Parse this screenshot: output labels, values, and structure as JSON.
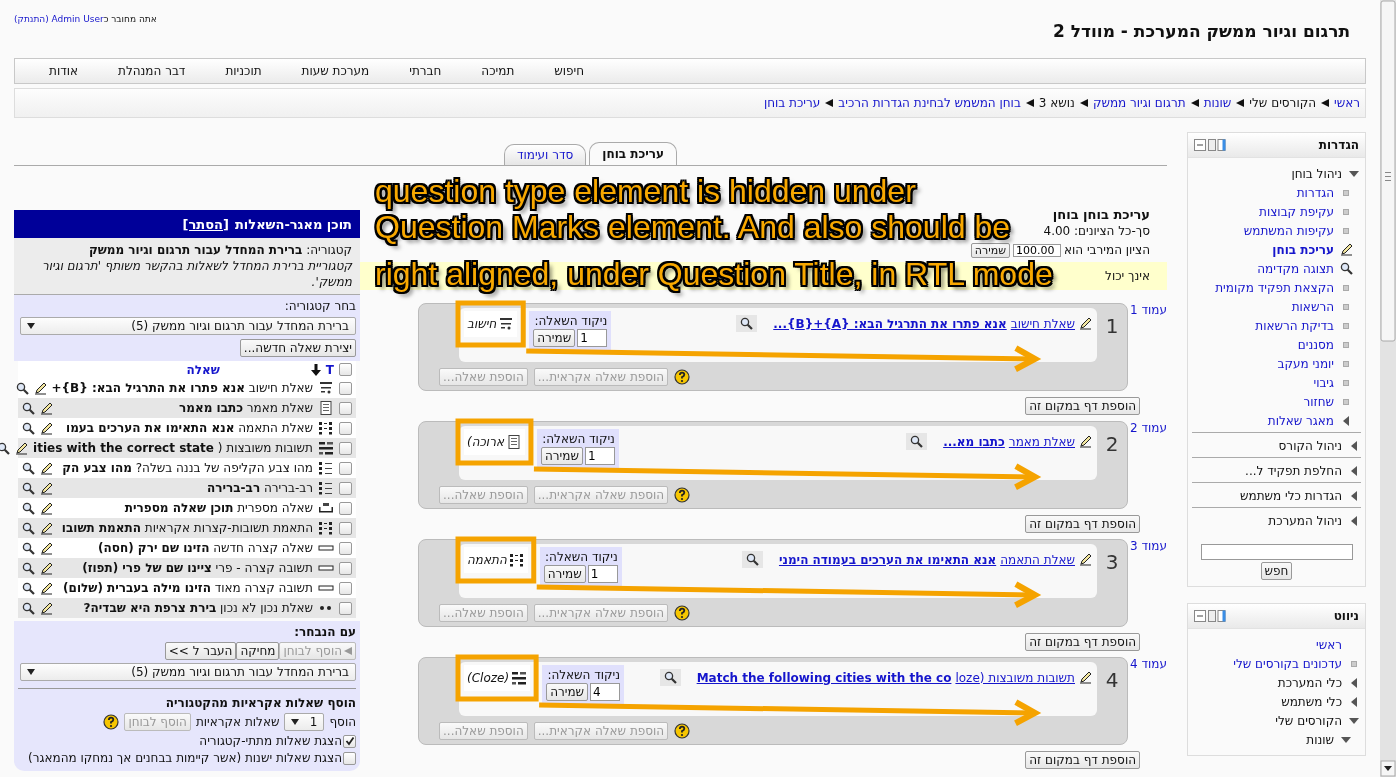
{
  "header": {
    "login_prefix": "אתה מחובר כ",
    "user": "Admin User",
    "logout": "(התנתק)",
    "site_title": "תרגום וגיור ממשק המערכת - מוודל 2"
  },
  "menu": [
    "חיפוש",
    "תמיכה",
    "חברתי",
    "מערכת שעות",
    "תוכניות",
    "דבר המנהלת",
    "אודות"
  ],
  "breadcrumb": [
    {
      "label": "ראשי",
      "link": true
    },
    {
      "label": "הקורסים שלי",
      "link": false
    },
    {
      "label": "שונות",
      "link": true
    },
    {
      "label": "תרגום וגיור ממשק",
      "link": true
    },
    {
      "label": "נושא 3",
      "link": false
    },
    {
      "label": "בוחן המשמש לבחינת הגדרות הרכיב",
      "link": true
    },
    {
      "label": "עריכת בוחן",
      "link": true
    }
  ],
  "tabs": [
    {
      "label": "עריכת בוחן",
      "selected": true
    },
    {
      "label": "סדר ועימוד",
      "selected": false
    }
  ],
  "bank": {
    "title": "תוכן מאגר-השאלות",
    "hide_link": "[הסתר]",
    "category_label": "קטגוריה:",
    "category_name": "ברירת המחדל עבור תרגום וגיור ממשק",
    "category_info": "קטגוריית ברירת המחדל לשאלות בהקשר משותף 'תרגום וגיור ממשק'.",
    "choose_label": "בחר קטגוריה:",
    "category_select": "ברירת המחדל עבור תרגום וגיור ממשק (5)",
    "new_button": "יצירת שאלה חדשה...",
    "select_all_checked": false,
    "type_column": "T",
    "question_column": "שאלה",
    "rows": [
      {
        "kind": "calculated",
        "type": "שאלת חישוב",
        "title": "אנא פתרו את התרגיל הבא: {B}+",
        "checked": false
      },
      {
        "kind": "essay",
        "type": "שאלת מאמר",
        "title": "כתבו מאמר",
        "checked": false
      },
      {
        "kind": "matching",
        "type": "שאלת התאמה",
        "title": "אנא התאימו את הערכים בעמו",
        "checked": false
      },
      {
        "kind": "multianswer",
        "type": "תשובות משובצות (",
        "title": "ities with the correct state",
        "checked": false
      },
      {
        "kind": "multichoice",
        "type": "מהו צבע הקליפה של בננה בשלה?",
        "title": "מהו צבע הק",
        "checked": false
      },
      {
        "kind": "multichoice",
        "type": "רב-ברירה",
        "title": "רב-ברירה",
        "checked": false
      },
      {
        "kind": "numerical",
        "type": "שאלה מספרית",
        "title": "תוכן שאלה מספרית",
        "checked": false
      },
      {
        "kind": "randomsamatch",
        "type": "התאמת תשובות-קצרות אקראיות",
        "title": "התאמת תשובו",
        "checked": false
      },
      {
        "kind": "shortanswer",
        "type": "שאלה קצרה חדשה",
        "title": "הזינו שם ירק (חסה)",
        "checked": false
      },
      {
        "kind": "shortanswer",
        "type": "תשובה קצרה - פרי",
        "title": "ציינו שם של פרי (תפוז)",
        "checked": false
      },
      {
        "kind": "shortanswer",
        "type": "תשובה קצרה מאוד",
        "title": "הזינו מילה בעברית (שלום)",
        "checked": false
      },
      {
        "kind": "truefalse",
        "type": "שאלת נכון לא נכון",
        "title": "בירת צרפת היא שבדיה?",
        "checked": false
      }
    ],
    "with_selected": "עם הנבחר:",
    "actions": [
      {
        "label": "הוסף לבוחן",
        "disabled": true
      },
      {
        "label": "מחיקה",
        "disabled": false
      },
      {
        "label": "העבר ל >>",
        "disabled": false
      }
    ],
    "move_select": "ברירת המחדל עבור תרגום וגיור ממשק (5)",
    "random_title": "הוסף שאלות אקראיות מהקטגוריה",
    "random_add": "הוסף",
    "random_count": "1",
    "random_label": "שאלות אקראיות",
    "random_button": {
      "label": "הוסף לבוחן",
      "disabled": true
    },
    "options": [
      {
        "label": "הצגת שאלות מתתי-קטגוריה",
        "checked": true
      },
      {
        "label": "הצגת שאלות ישנות (אשר קיימות בבחנים אך נמחקו מהמאגר)",
        "checked": false
      }
    ]
  },
  "quiz": {
    "heading": "עריכת בוחן בוחן",
    "total": "סך-כל הציונים: 4.00",
    "max_label": "הציון המירבי הוא",
    "max_value": "100.00",
    "save": "שמירה",
    "notice": "אינך יכול"
  },
  "pages": [
    {
      "page_label": "עמוד 1",
      "number": "1",
      "type_link": "שאלת חישוב",
      "title": "אנא פתרו את התרגיל הבא: {A}+{B}...",
      "grade_label": "ניקוד השאלה:",
      "grade": "1",
      "save": "שמירה",
      "qtype": {
        "kind": "calculated",
        "label": "חישוב"
      },
      "add_random": "הוספת שאלה אקראית...",
      "add_question": "הוספת שאלה...",
      "add_disabled": true,
      "add_page": "הוספת דף במקום זה",
      "annotated": true
    },
    {
      "page_label": "עמוד 2",
      "number": "2",
      "type_link": "שאלת מאמר",
      "title": "כתבו מא...",
      "grade_label": "ניקוד השאלה:",
      "grade": "1",
      "save": "שמירה",
      "qtype": {
        "kind": "essay",
        "label": "ארוכה)"
      },
      "add_random": "הוספת שאלה אקראית...",
      "add_question": "הוספת שאלה...",
      "add_disabled": true,
      "add_page": "הוספת דף במקום זה",
      "annotated": true
    },
    {
      "page_label": "עמוד 3",
      "number": "3",
      "type_link": "שאלת התאמה",
      "title": "אנא התאימו את הערכים בעמודה הימני",
      "grade_label": "ניקוד השאלה:",
      "grade": "1",
      "save": "שמירה",
      "qtype": {
        "kind": "matching",
        "label": "התאמה"
      },
      "add_random": "הוספת שאלה אקראית...",
      "add_question": "הוספת שאלה...",
      "add_disabled": true,
      "add_page": "הוספת דף במקום זה",
      "annotated": true
    },
    {
      "page_label": "עמוד 4",
      "number": "4",
      "type_link": "תשובות משובצות (loze",
      "title": "Match the following cities with the co",
      "grade_label": "ניקוד השאלה:",
      "grade": "4",
      "save": "שמירה",
      "qtype": {
        "kind": "multianswer",
        "label": "(Cloze)"
      },
      "add_random": "הוספת שאלה אקראית...",
      "add_question": "הוספת שאלה...",
      "add_disabled": true,
      "add_page": "הוספת דף במקום זה",
      "annotated": true
    }
  ],
  "annotation": {
    "lines": [
      "question type element is hidden under",
      "Question Marks element. And also should be",
      "right aligned, under Question Title, in RTL mode"
    ]
  },
  "settings": {
    "title": "הגדרות",
    "search_button": "חפש",
    "tree": [
      {
        "label": "ניהול בוחן",
        "kind": "branch",
        "expanded": true,
        "link": false,
        "children": [
          {
            "label": "הגדרות",
            "kind": "bullet",
            "selected": false
          },
          {
            "label": "עקיפת קבוצות",
            "kind": "bullet",
            "selected": false
          },
          {
            "label": "עקיפות המשתמש",
            "kind": "bullet",
            "selected": false
          },
          {
            "label": "עריכת בוחן",
            "kind": "edit",
            "selected": true
          },
          {
            "label": "תצוגה מקדימה",
            "kind": "preview",
            "selected": false
          },
          {
            "label": "הקצאת תפקיד מקומית",
            "kind": "bullet",
            "selected": false
          },
          {
            "label": "הרשאות",
            "kind": "bullet",
            "selected": false
          },
          {
            "label": "בדיקת הרשאות",
            "kind": "bullet",
            "selected": false
          },
          {
            "label": "מסננים",
            "kind": "bullet",
            "selected": false
          },
          {
            "label": "יומני מעקב",
            "kind": "bullet",
            "selected": false
          },
          {
            "label": "גיבוי",
            "kind": "bullet",
            "selected": false
          },
          {
            "label": "שחזור",
            "kind": "bullet",
            "selected": false
          },
          {
            "label": "מאגר שאלות",
            "kind": "branch",
            "expanded": false,
            "link": true
          }
        ]
      },
      {
        "label": "ניהול הקורס",
        "kind": "branch",
        "expanded": false,
        "link": false
      },
      {
        "label": "החלפת תפקיד ל...",
        "kind": "branch",
        "expanded": false,
        "link": false
      },
      {
        "label": "הגדרות כלי משתמש",
        "kind": "branch",
        "expanded": false,
        "link": false
      },
      {
        "label": "ניהול המערכת",
        "kind": "branch",
        "expanded": false,
        "link": false
      }
    ]
  },
  "navigation": {
    "title": "ניווט",
    "tree": [
      {
        "label": "ראשי",
        "kind": "plain",
        "selected": false
      },
      {
        "label": "עדכונים בקורסים שלי",
        "kind": "bullet",
        "selected": false
      },
      {
        "label": "כלי המערכת",
        "kind": "branch",
        "expanded": false,
        "link": false
      },
      {
        "label": "כלי משתמש",
        "kind": "branch",
        "expanded": false,
        "link": false
      },
      {
        "label": "הקורסים שלי",
        "kind": "branch",
        "expanded": true,
        "link": false,
        "children": [
          {
            "label": "שונות",
            "kind": "branch",
            "expanded": true,
            "link": false
          }
        ]
      }
    ]
  }
}
